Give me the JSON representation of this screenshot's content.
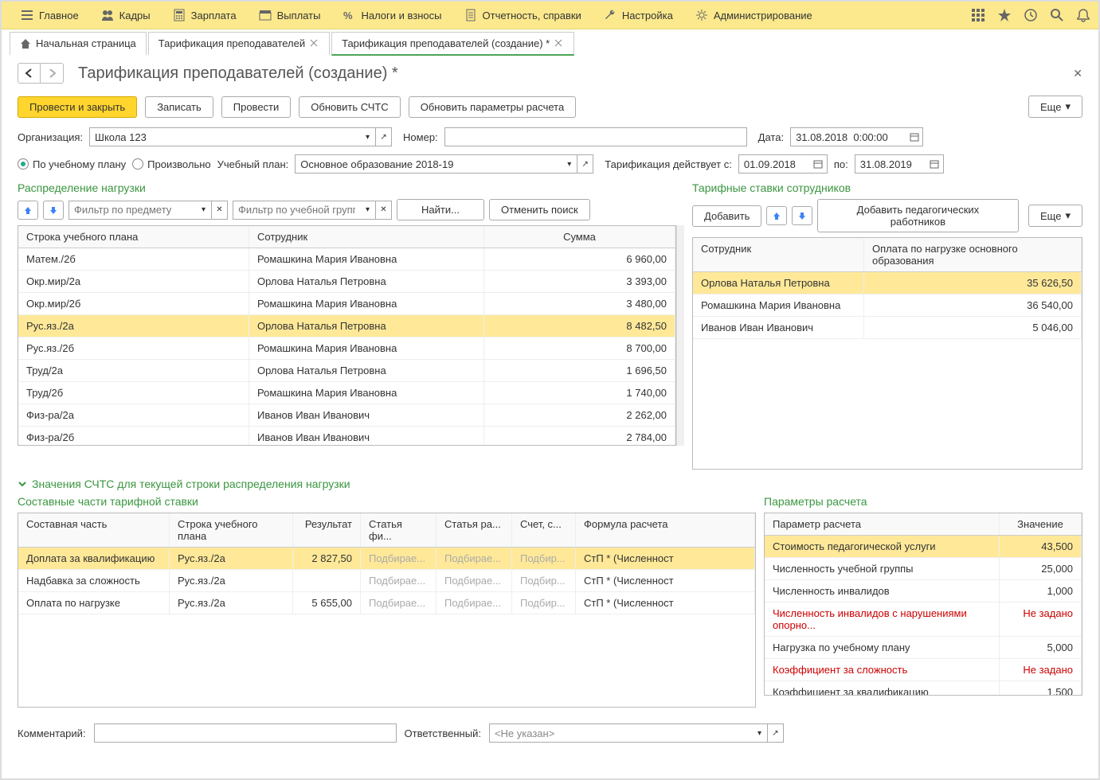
{
  "menu": {
    "main": "Главное",
    "hr": "Кадры",
    "salary": "Зарплата",
    "payments": "Выплаты",
    "taxes": "Налоги и взносы",
    "reports": "Отчетность, справки",
    "setup": "Настройка",
    "admin": "Администрирование"
  },
  "tabs": {
    "start": "Начальная страница",
    "t1": "Тарификация преподавателей",
    "t2": "Тарификация преподавателей (создание) *"
  },
  "page": {
    "title": "Тарификация преподавателей (создание) *"
  },
  "buttons": {
    "postclose": "Провести и закрыть",
    "write": "Записать",
    "post": "Провести",
    "updateSCHTS": "Обновить СЧТС",
    "updateParams": "Обновить параметры расчета",
    "more": "Еще",
    "find": "Найти...",
    "cancelFind": "Отменить поиск",
    "add": "Добавить",
    "addTeachers": "Добавить педагогических работников"
  },
  "labels": {
    "org": "Организация:",
    "number": "Номер:",
    "date": "Дата:",
    "byPlan": "По учебному плану",
    "arbitrary": "Произвольно",
    "studyPlan": "Учебный план:",
    "effectiveFrom": "Тарификация действует с:",
    "to": "по:",
    "loadDist": "Распределение нагрузки",
    "emplRates": "Тарифные ставки сотрудников",
    "planLine": "Строка учебного плана",
    "employee": "Сотрудник",
    "sum": "Сумма",
    "payment": "Оплата по нагрузке основного образования",
    "schts": "Значения СЧТС для текущей строки распределения нагрузки",
    "rateParts": "Составные части тарифной ставки",
    "calcParams": "Параметры расчета",
    "part": "Составная часть",
    "result": "Результат",
    "finArt": "Статья фи...",
    "expArt": "Статья ра...",
    "acc": "Счет, с...",
    "formula": "Формула расчета",
    "param": "Параметр расчета",
    "value": "Значение",
    "filterSubj": "Фильтр по предмету",
    "filterGroup": "Фильтр по учебной группе",
    "comment": "Комментарий:",
    "responsible": "Ответственный:",
    "notSet": "<Не указан>",
    "picking": "Подбирае...",
    "pick2": "Подбир...",
    "notGiven": "Не задано"
  },
  "values": {
    "org": "Школа 123",
    "date": "31.08.2018  0:00:00",
    "plan": "Основное образование 2018-19",
    "from": "01.09.2018",
    "to": "31.08.2019"
  },
  "loadRows": [
    {
      "line": "Матем./2б",
      "emp": "Ромашкина Мария Ивановна",
      "sum": "6 960,00"
    },
    {
      "line": "Окр.мир/2а",
      "emp": "Орлова Наталья Петровна",
      "sum": "3 393,00"
    },
    {
      "line": "Окр.мир/2б",
      "emp": "Ромашкина Мария Ивановна",
      "sum": "3 480,00"
    },
    {
      "line": "Рус.яз./2а",
      "emp": "Орлова Наталья Петровна",
      "sum": "8 482,50",
      "sel": true
    },
    {
      "line": "Рус.яз./2б",
      "emp": "Ромашкина Мария Ивановна",
      "sum": "8 700,00"
    },
    {
      "line": "Труд/2а",
      "emp": "Орлова Наталья Петровна",
      "sum": "1 696,50"
    },
    {
      "line": "Труд/2б",
      "emp": "Ромашкина Мария Ивановна",
      "sum": "1 740,00"
    },
    {
      "line": "Физ-ра/2а",
      "emp": "Иванов Иван Иванович",
      "sum": "2 262,00"
    },
    {
      "line": "Физ-ра/2б",
      "emp": "Иванов Иван Иванович",
      "sum": "2 784,00"
    }
  ],
  "rateRows": [
    {
      "emp": "Орлова Наталья Петровна",
      "pay": "35 626,50",
      "sel": true
    },
    {
      "emp": "Ромашкина Мария Ивановна",
      "pay": "36 540,00"
    },
    {
      "emp": "Иванов Иван Иванович",
      "pay": "5 046,00"
    }
  ],
  "partRows": [
    {
      "part": "Доплата за квалификацию",
      "line": "Рус.яз./2а",
      "res": "2 827,50",
      "formula": "СтП * (Численност",
      "sel": true
    },
    {
      "part": "Надбавка за сложность",
      "line": "Рус.яз./2а",
      "res": "",
      "formula": "СтП * (Численност"
    },
    {
      "part": "Оплата по нагрузке",
      "line": "Рус.яз./2а",
      "res": "5 655,00",
      "formula": "СтП * (Численност"
    }
  ],
  "paramRows": [
    {
      "p": "Стоимость педагогической услуги",
      "v": "43,500",
      "sel": true
    },
    {
      "p": "Численность учебной группы",
      "v": "25,000"
    },
    {
      "p": "Численность инвалидов",
      "v": "1,000"
    },
    {
      "p": "Численность инвалидов с нарушениями опорно...",
      "v": "Не задано",
      "red": true
    },
    {
      "p": "Нагрузка по учебному плану",
      "v": "5,000"
    },
    {
      "p": "Коэффициент за сложность",
      "v": "Не задано",
      "red": true
    },
    {
      "p": "Коэффициент за квалификацию",
      "v": "1,500"
    }
  ]
}
